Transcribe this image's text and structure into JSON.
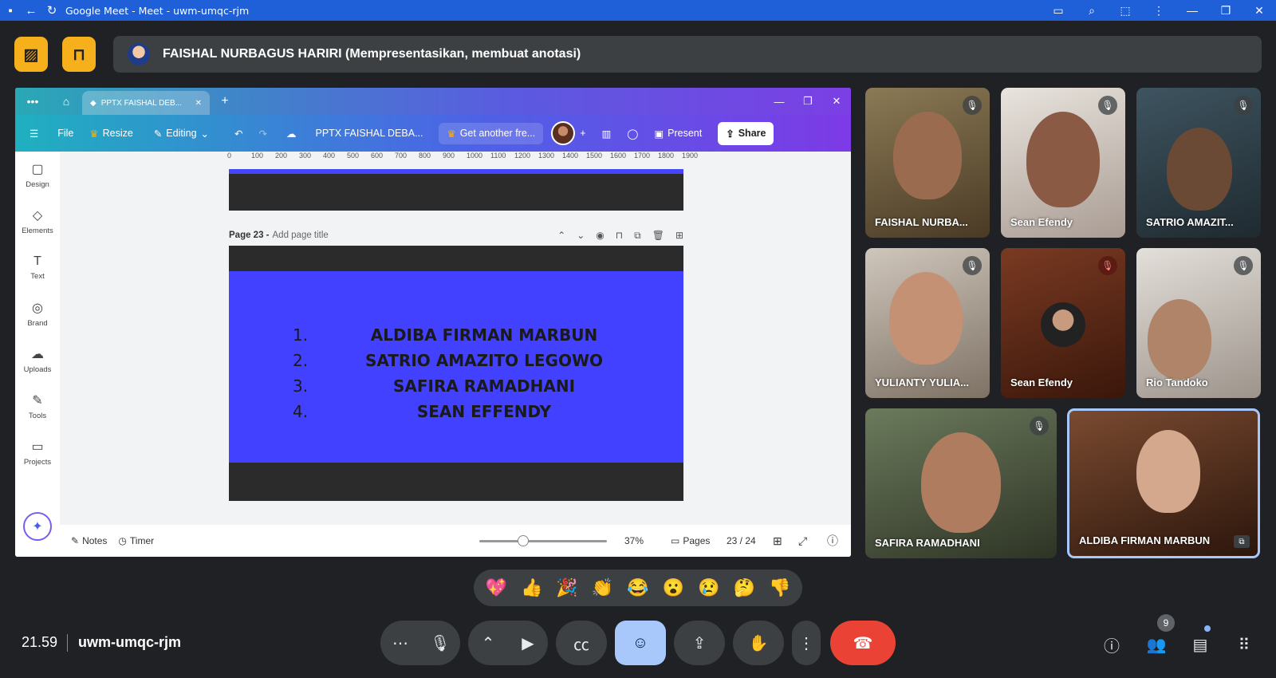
{
  "window": {
    "title": "Google Meet - Meet - uwm-umqc-rjm"
  },
  "presenter": {
    "text": "FAISHAL NURBAGUS HARIRI (Mempresentasikan, membuat anotasi)"
  },
  "canva": {
    "tab_title": "PPTX FAISHAL DEB...",
    "toolbar": {
      "file": "File",
      "resize": "Resize",
      "editing": "Editing",
      "doc_title": "PPTX FAISHAL DEBA...",
      "get_another": "Get another fre...",
      "present": "Present",
      "share": "Share"
    },
    "sidebar": [
      {
        "label": "Design",
        "icon": "design-icon",
        "glyph": "▢"
      },
      {
        "label": "Elements",
        "icon": "elements-icon",
        "glyph": "◇"
      },
      {
        "label": "Text",
        "icon": "text-icon",
        "glyph": "T"
      },
      {
        "label": "Brand",
        "icon": "brand-icon",
        "glyph": "◎"
      },
      {
        "label": "Uploads",
        "icon": "uploads-icon",
        "glyph": "☁"
      },
      {
        "label": "Tools",
        "icon": "tools-icon",
        "glyph": "✎"
      },
      {
        "label": "Projects",
        "icon": "projects-icon",
        "glyph": "▭"
      }
    ],
    "ruler_top": [
      "0",
      "100",
      "200",
      "300",
      "400",
      "500",
      "600",
      "700",
      "800",
      "900",
      "1000",
      "1100",
      "1200",
      "1300",
      "1400",
      "1500",
      "1600",
      "1700",
      "1800",
      "1900"
    ],
    "page": {
      "label": "Page 23 -",
      "add_title": "Add page title"
    },
    "slide_items": [
      {
        "num": "1.",
        "name": "ALDIBA FIRMAN MARBUN"
      },
      {
        "num": "2.",
        "name": "SATRIO AMAZITO LEGOWO"
      },
      {
        "num": "3.",
        "name": "SAFIRA RAMADHANI"
      },
      {
        "num": "4.",
        "name": "SEAN EFFENDY"
      }
    ],
    "bottom": {
      "notes": "Notes",
      "timer": "Timer",
      "zoom": "37%",
      "pages": "Pages",
      "page_count": "23 / 24",
      "zoom_level": 0.37
    }
  },
  "participants": [
    {
      "name": "FAISHAL NURBA...",
      "muted": true
    },
    {
      "name": "Sean Efendy",
      "muted": true
    },
    {
      "name": "SATRIO AMAZIT...",
      "muted": true
    },
    {
      "name": "YULIANTY YULIA...",
      "muted": true
    },
    {
      "name": "Sean Efendy",
      "muted": true
    },
    {
      "name": "Rio Tandoko",
      "muted": true
    },
    {
      "name": "SAFIRA RAMADHANI",
      "muted": true
    },
    {
      "name": "ALDIBA FIRMAN MARBUN",
      "muted": false
    }
  ],
  "reactions": [
    "💖",
    "👍",
    "🎉",
    "👏",
    "😂",
    "😮",
    "😢",
    "🤔",
    "👎"
  ],
  "meeting": {
    "time": "21.59",
    "code": "uwm-umqc-rjm",
    "participant_count": "9"
  },
  "colors": {
    "accent_blue": "#1f5fd8",
    "slide_blue": "#4141ff",
    "end_call": "#ea4335",
    "active_button": "#a8c7fa"
  }
}
